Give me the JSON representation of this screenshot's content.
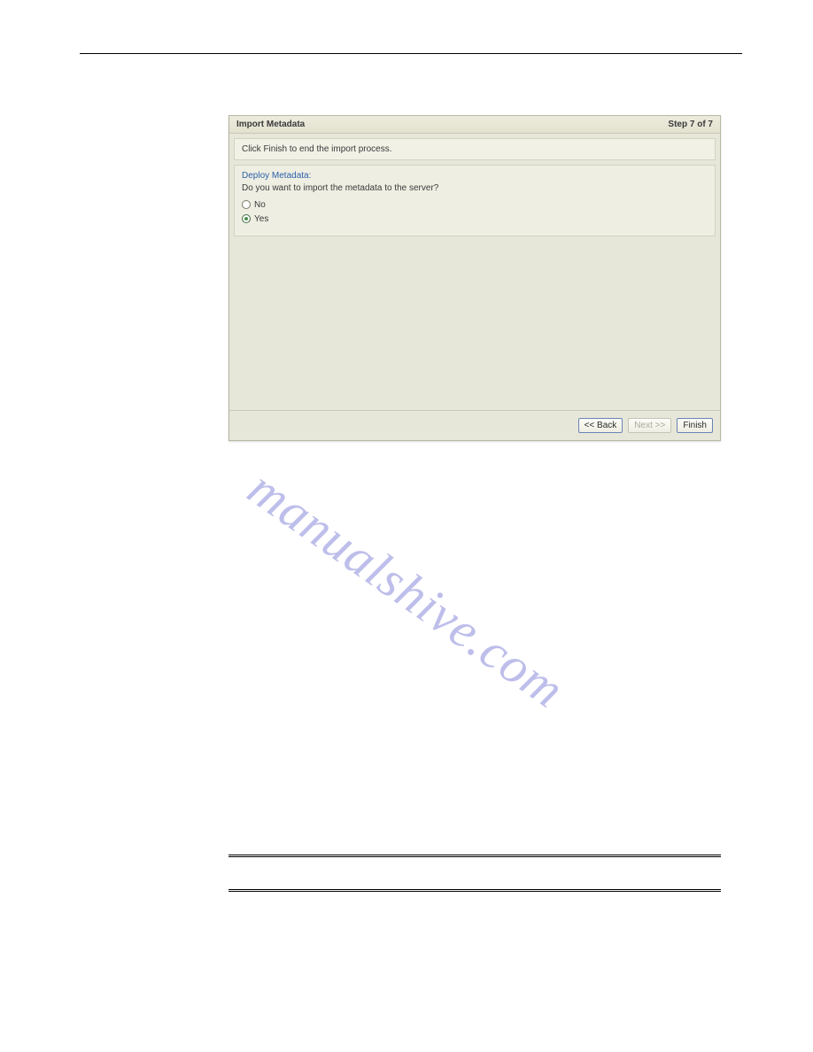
{
  "dialog": {
    "title": "Import Metadata",
    "step": "Step 7 of 7",
    "instruction": "Click Finish to end the import process.",
    "section_label": "Deploy Metadata:",
    "question": "Do you want to import the metadata to the server?",
    "options": {
      "no": "No",
      "yes": "Yes"
    },
    "selected": "yes",
    "buttons": {
      "back": "<< Back",
      "next": "Next >>",
      "finish": "Finish"
    }
  },
  "watermark": "manualshive.com"
}
